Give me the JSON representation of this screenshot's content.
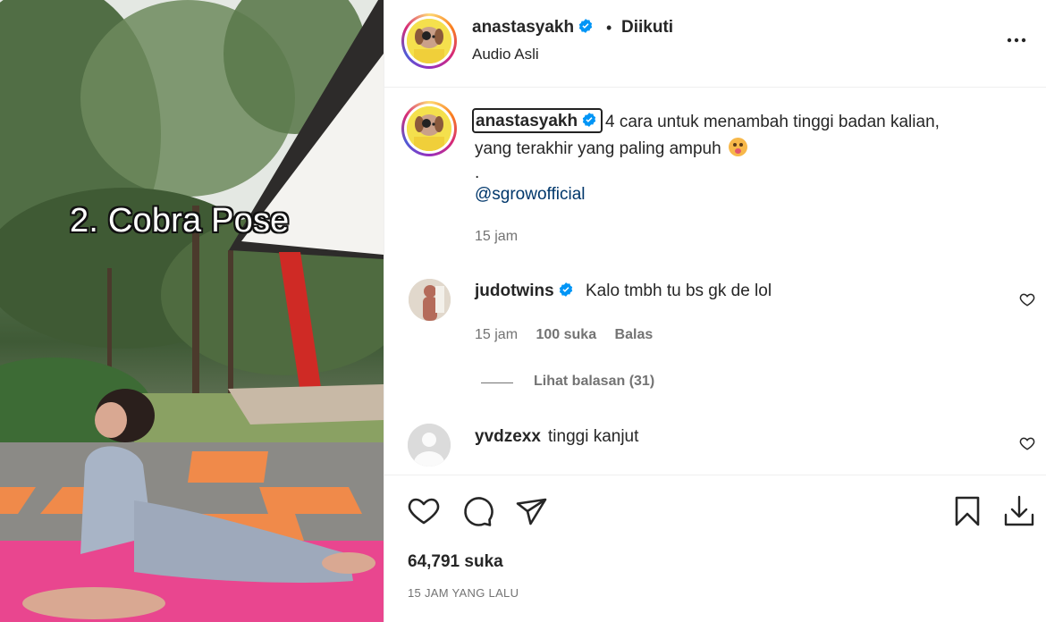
{
  "video": {
    "overlay_text": "2. Cobra Pose"
  },
  "header": {
    "username": "anastasyakh",
    "verified": true,
    "separator": "•",
    "follow_status": "Diikuti",
    "audio": "Audio Asli",
    "more_icon": "more-horizontal-icon"
  },
  "caption": {
    "username": "anastasyakh",
    "verified": true,
    "line1": "4 cara untuk menambah tinggi badan kalian,",
    "line2": "yang terakhir yang paling ampuh",
    "emoji": "flushed-face-emoji",
    "line3": ".",
    "mention": "@sgrowofficial",
    "time": "15 jam"
  },
  "comments": [
    {
      "username": "judotwins",
      "verified": true,
      "text": "Kalo tmbh tu bs gk de lol",
      "time": "15 jam",
      "likes": "100 suka",
      "reply_label": "Balas",
      "view_replies": "Lihat balasan (31)"
    },
    {
      "username": "yvdzexx",
      "verified": false,
      "text": "tinggi kanjut"
    }
  ],
  "actions": {
    "like_count": "64,791 suka",
    "posted": "15 JAM YANG LALU"
  },
  "colors": {
    "text": "#262626",
    "secondary": "#737373",
    "link": "#00376b",
    "verified": "#0095f6",
    "divider": "#efefef"
  }
}
